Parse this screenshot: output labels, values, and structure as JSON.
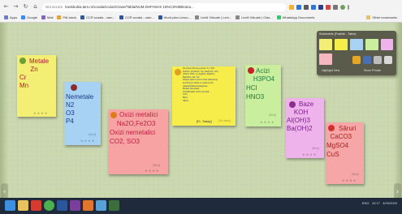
{
  "browser": {
    "address_prefix": "Not secure",
    "address": "lewiskubia.tam.ro/scoala/scolari/Clase/Tabla/NUM-DHFHxHX 18%C8%9Bleana...",
    "bookmarks": [
      "Apps",
      "Google",
      "Mail",
      "Pdf-stock",
      "CCR scoala - cam...",
      "CCR scoala - cam...",
      "Word plan Lesso...",
      "Lectii Virtuale | Lect...",
      "Lectii Virtuale | Clas...",
      "WhatsApp Documents",
      "Other bookmarks"
    ]
  },
  "notes": [
    {
      "title": "Metale",
      "body": "      Zn\nCr\nMn",
      "color": "#f3ee74"
    },
    {
      "title": "Nemetale",
      "body": "N2\nO3\nP4",
      "color": "#a8d2f3"
    },
    {
      "title": "Oxizi metalici",
      "body": "    Na2O,Fe2O3\nOxizi nemetalici\nCO2, SO3",
      "color": "#f7a3a3"
    },
    {
      "title": "",
      "body": "",
      "color": "#f6ec4a"
    },
    {
      "title": "Acizi",
      "body": "    H3PO4\nHCl\nHNO3",
      "color": "#c9ef9e"
    },
    {
      "title": "Baze",
      "body": "    KOH\nAl(OH)3\nBa(OH)2",
      "color": "#efb3ec"
    },
    {
      "title": "Săruri",
      "body": "  CaCO3\nMgSO4\nCuS",
      "color": "#f6a6a6"
    }
  ],
  "yellow_note": {
    "text": "De clasa Chimie (pentru 7): CO2,\nFePO4, Zn(OH)2, Ca, Na2CO3, HCl,\nHNO3, PbI2, Li, AgNO3, MgSO4,\nBa(OH)2, N2, P4\nPlease add in and to their (Rename)\nand Post-it Notes to capture the\nrelated/Tables/Categories\nMetale Nemetale\nOxiziMetalici Oxizi nemetal...\nAcizi\nBaze\nSăruri",
    "author": "[Fr, Today]",
    "tag": "[16 clasa]"
  },
  "palette": {
    "header": "Subiectele (Palette - Tabla)",
    "swatches": [
      "#f3ee74",
      "#f6ec4a",
      "#a8d2f3",
      "#c9ef9e",
      "#efb3ec",
      "#f7b7c1"
    ],
    "footer_left": "Highlight New",
    "footer_right": "Show Private"
  },
  "taskbar": {
    "clock": "10:17",
    "date": "4/20/2020",
    "lang": "ENG"
  }
}
